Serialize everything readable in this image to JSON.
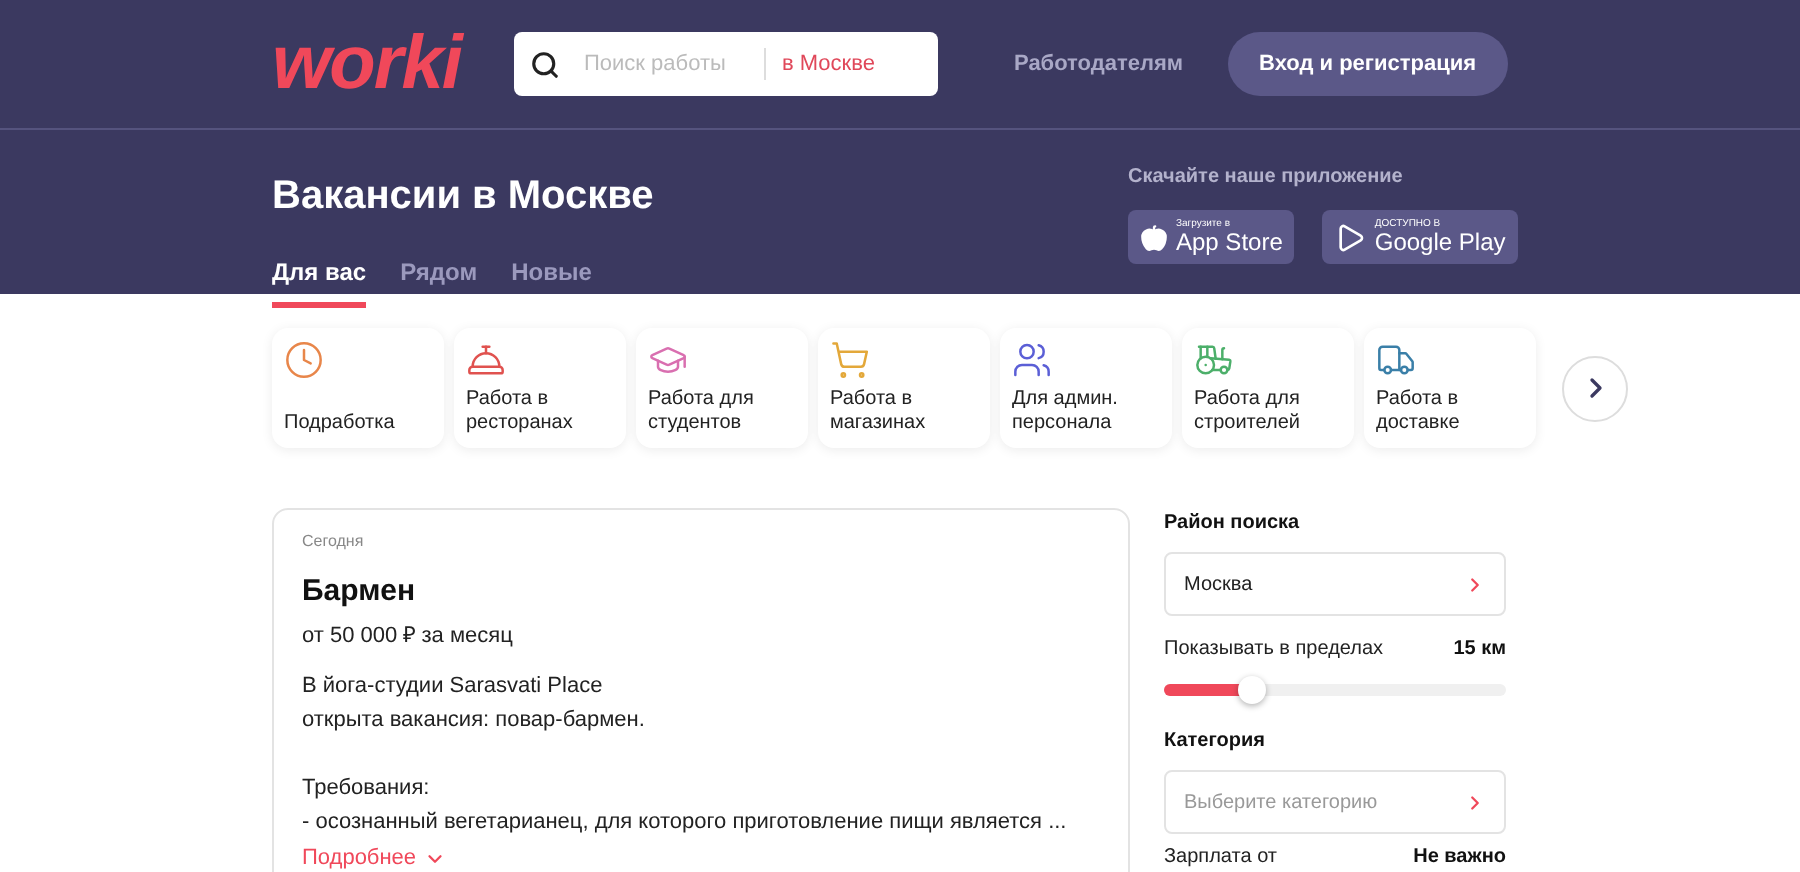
{
  "header": {
    "logo": "worki",
    "search": {
      "placeholder": "Поиск работы",
      "location": "в Москве"
    },
    "employers_link": "Работодателям",
    "login_button": "Вход и регистрация"
  },
  "hero": {
    "title": "Вакансии в Москве",
    "tabs": [
      {
        "label": "Для вас",
        "selected": true
      },
      {
        "label": "Рядом",
        "selected": false
      },
      {
        "label": "Новые",
        "selected": false
      }
    ],
    "app_promo": {
      "caption": "Скачайте наше приложение",
      "stores": [
        {
          "kind": "apple",
          "small": "Загрузите в",
          "big": "App Store"
        },
        {
          "kind": "google",
          "small": "ДОСТУПНО В",
          "big": "Google Play"
        }
      ]
    }
  },
  "categories": [
    {
      "label": "Подработка",
      "color": "#e8864a"
    },
    {
      "label": "Работа в ресторанах",
      "color": "#e0524f"
    },
    {
      "label": "Работа для студентов",
      "color": "#d96fb0"
    },
    {
      "label": "Работа в магазинах",
      "color": "#e3a83a"
    },
    {
      "label": "Для админ. персонала",
      "color": "#5b5fd6"
    },
    {
      "label": "Работа для строителей",
      "color": "#4caf6a"
    },
    {
      "label": "Работа в доставке",
      "color": "#3a7fa8"
    }
  ],
  "vacancy": {
    "date": "Сегодня",
    "title": "Бармен",
    "salary": "от 50 000 ₽ за месяц",
    "description": [
      [
        "В йога-студии Sarasvati Place",
        "открыта вакансия: повар-бармен."
      ],
      [
        "Требования:",
        "- осознанный вегетарианец, для которого приготовление пищи является ..."
      ]
    ],
    "more_link": "Подробнее"
  },
  "filters": {
    "area_label": "Район поиска",
    "area_value": "Москва",
    "radius_label": "Показывать в пределах",
    "radius_value": "15 км",
    "radius_slider": {
      "level": 0.26
    },
    "category_label": "Категория",
    "category_placeholder": "Выберите категорию",
    "salary_label": "Зарплата от",
    "salary_value": "Не важно"
  }
}
